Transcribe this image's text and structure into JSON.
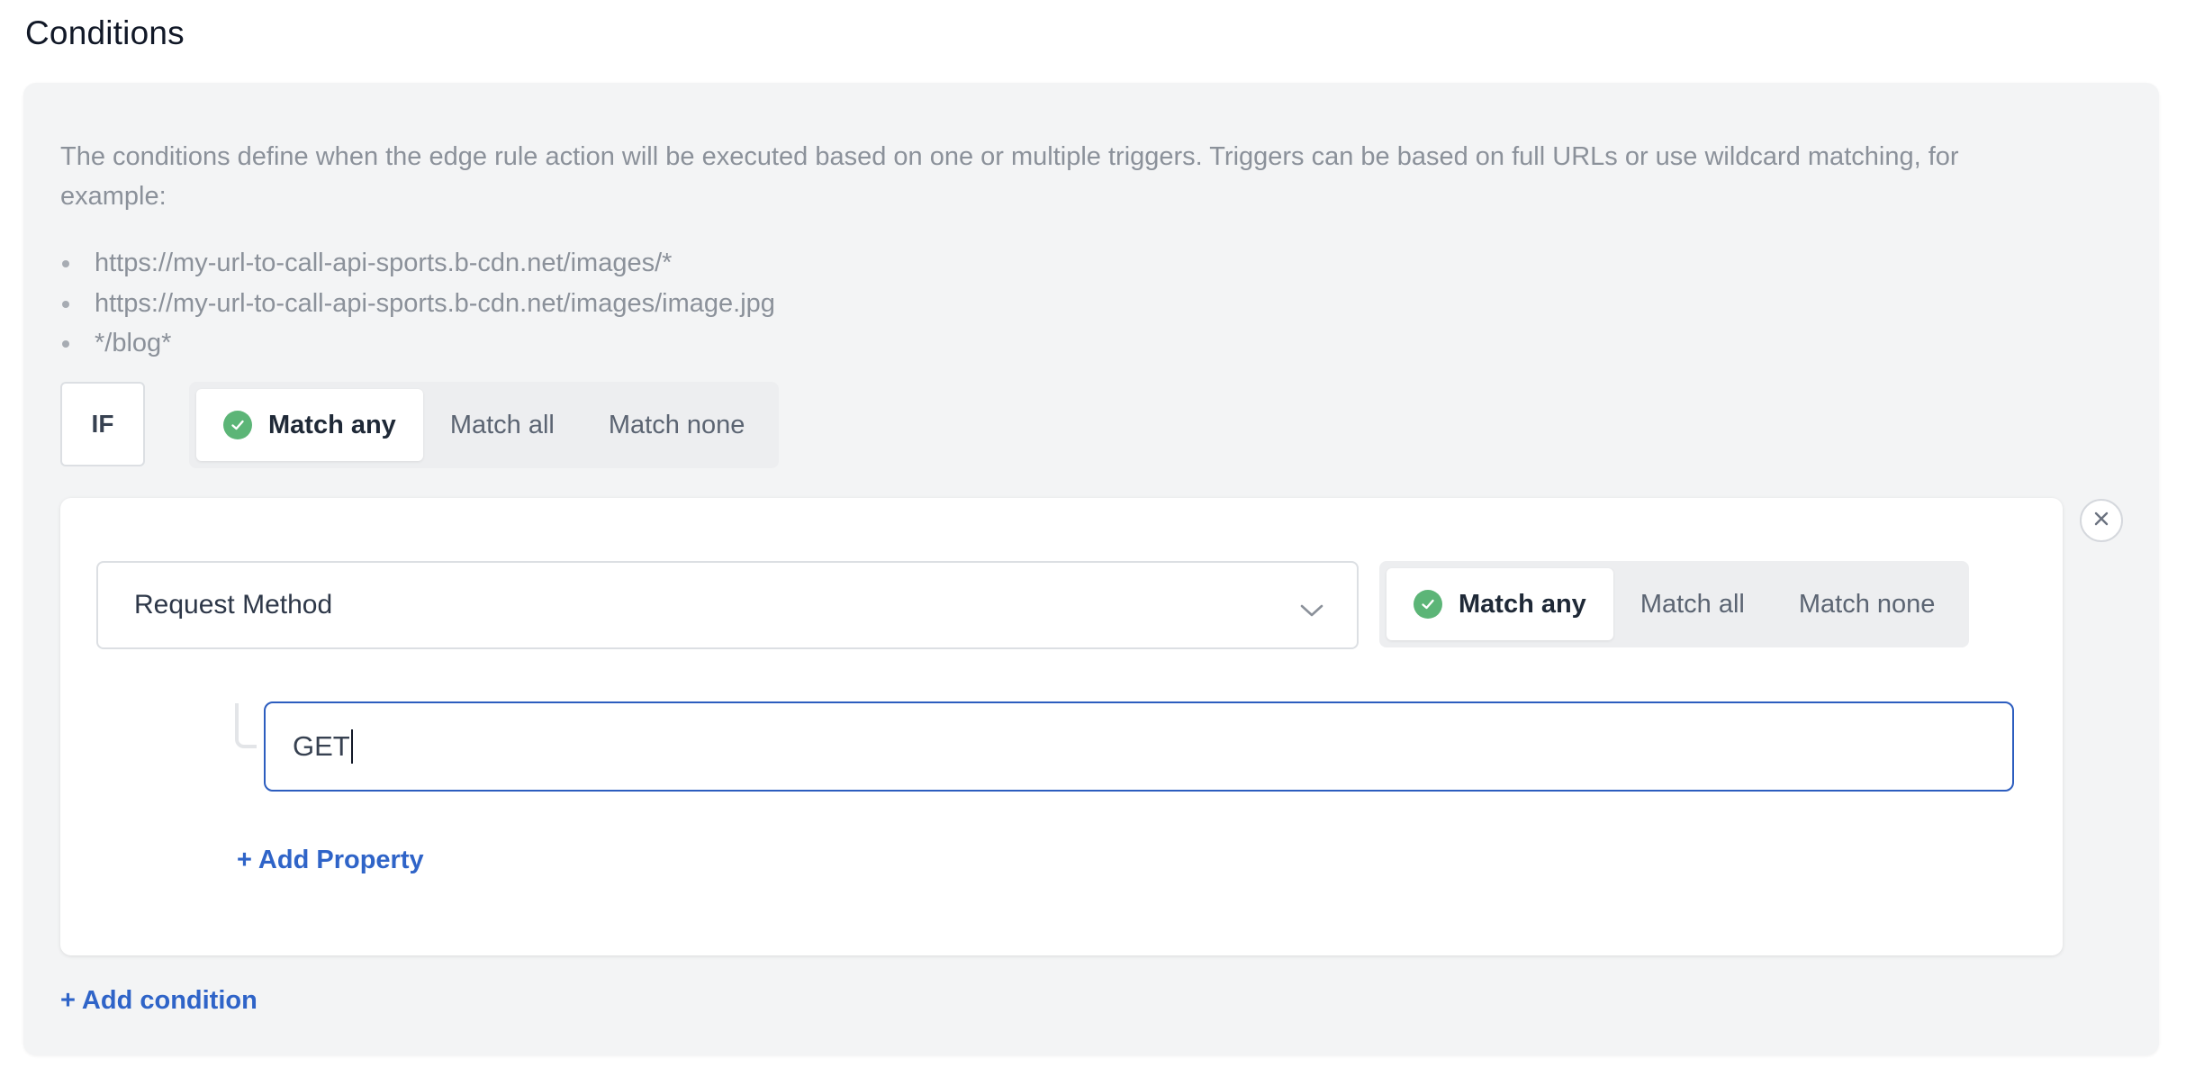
{
  "section": {
    "title": "Conditions"
  },
  "description": "The conditions define when the edge rule action will be executed based on one or multiple triggers. Triggers can be based on full URLs or use wildcard matching, for example:",
  "examples": [
    "https://my-url-to-call-api-sports.b-cdn.net/images/*",
    "https://my-url-to-call-api-sports.b-cdn.net/images/image.jpg",
    "*/blog*"
  ],
  "trigger_group": {
    "if_label": "IF",
    "match_options": [
      "Match any",
      "Match all",
      "Match none"
    ],
    "selected": "Match any"
  },
  "condition": {
    "type_select": {
      "value": "Request Method"
    },
    "match_options": [
      "Match any",
      "Match all",
      "Match none"
    ],
    "selected": "Match any",
    "property_value": "GET",
    "add_property_label": "+ Add Property"
  },
  "add_condition_label": "+ Add condition",
  "colors": {
    "accent_link": "#2f64c8",
    "input_focus_border": "#2c5dbf",
    "check_green": "#5cb577",
    "panel_bg": "#f3f4f5"
  },
  "icons": {
    "check": "check-circle-icon",
    "close": "close-icon",
    "dropdown": "chevron-down-icon"
  }
}
